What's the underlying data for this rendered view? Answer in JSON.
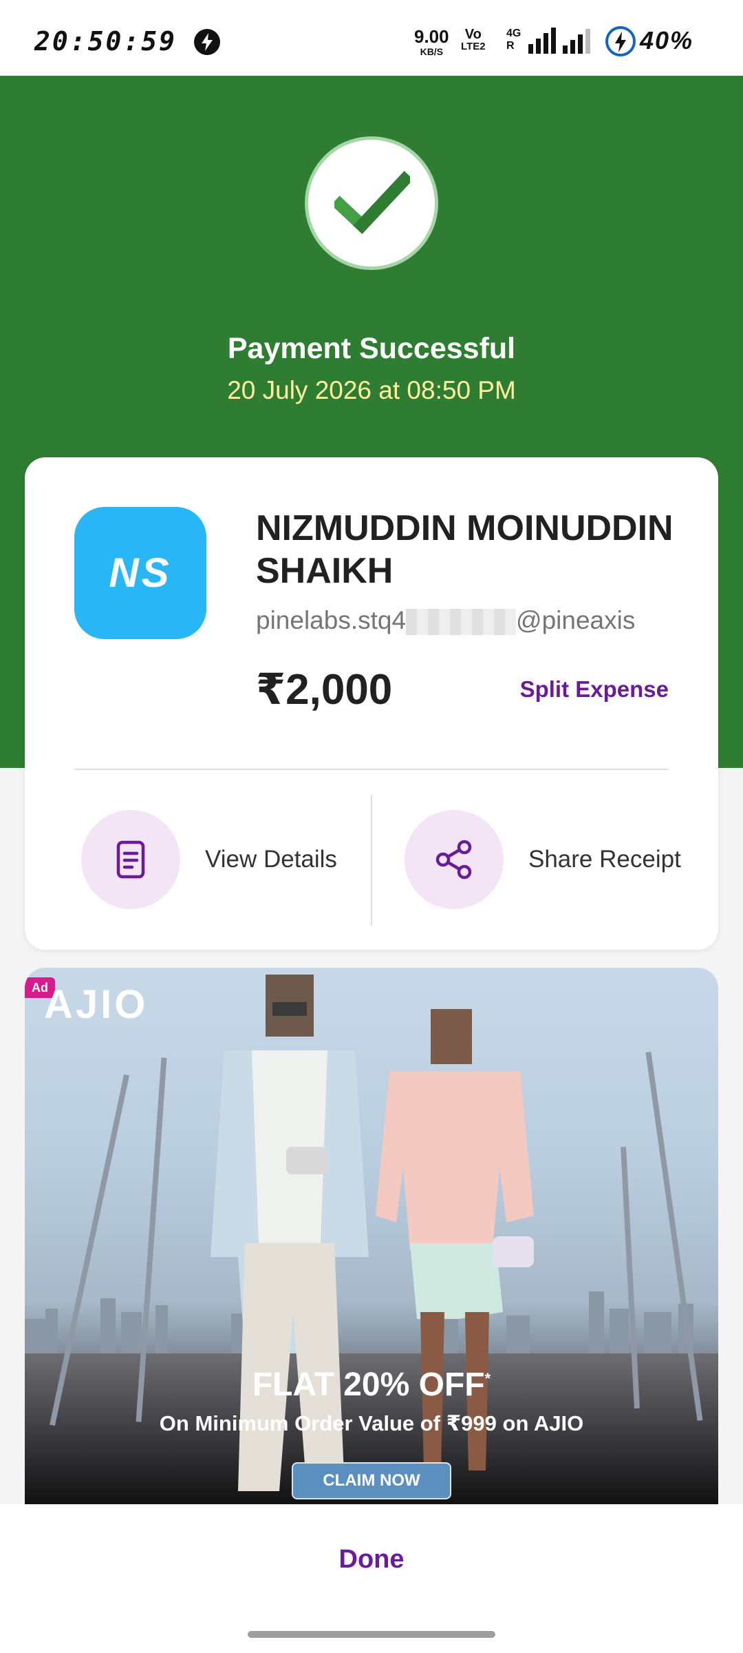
{
  "status_bar": {
    "time": "20:50:59",
    "net_speed": "9.00",
    "net_speed_unit": "KB/S",
    "volte_top": "Vo",
    "volte_bottom": "LTE2",
    "network_top": "4G",
    "network_bottom": "R",
    "battery": "40%"
  },
  "payment": {
    "status_title": "Payment Successful",
    "datetime": "20 July 2026 at 08:50 PM"
  },
  "payee": {
    "initials": "NS",
    "name": "NIZMUDDIN MOINUDDIN SHAIKH",
    "upi_prefix": "pinelabs.stq4",
    "upi_suffix": "@pineaxis",
    "amount": "₹2,000",
    "split_label": "Split Expense"
  },
  "actions": {
    "view_details": "View Details",
    "share_receipt": "Share Receipt"
  },
  "ad": {
    "badge": "Ad",
    "brand": "AJIO",
    "offer_main": "FLAT 20% OFF",
    "offer_mark": "*",
    "offer_sub": "On Minimum Order Value of ₹999 on AJIO",
    "cta": "CLAIM NOW"
  },
  "footer": {
    "done_label": "Done"
  },
  "colors": {
    "hero_green": "#2e7d32",
    "accent_purple": "#6a1b9a",
    "avatar_blue": "#29b6f6",
    "date_yellow": "#fff59d"
  }
}
